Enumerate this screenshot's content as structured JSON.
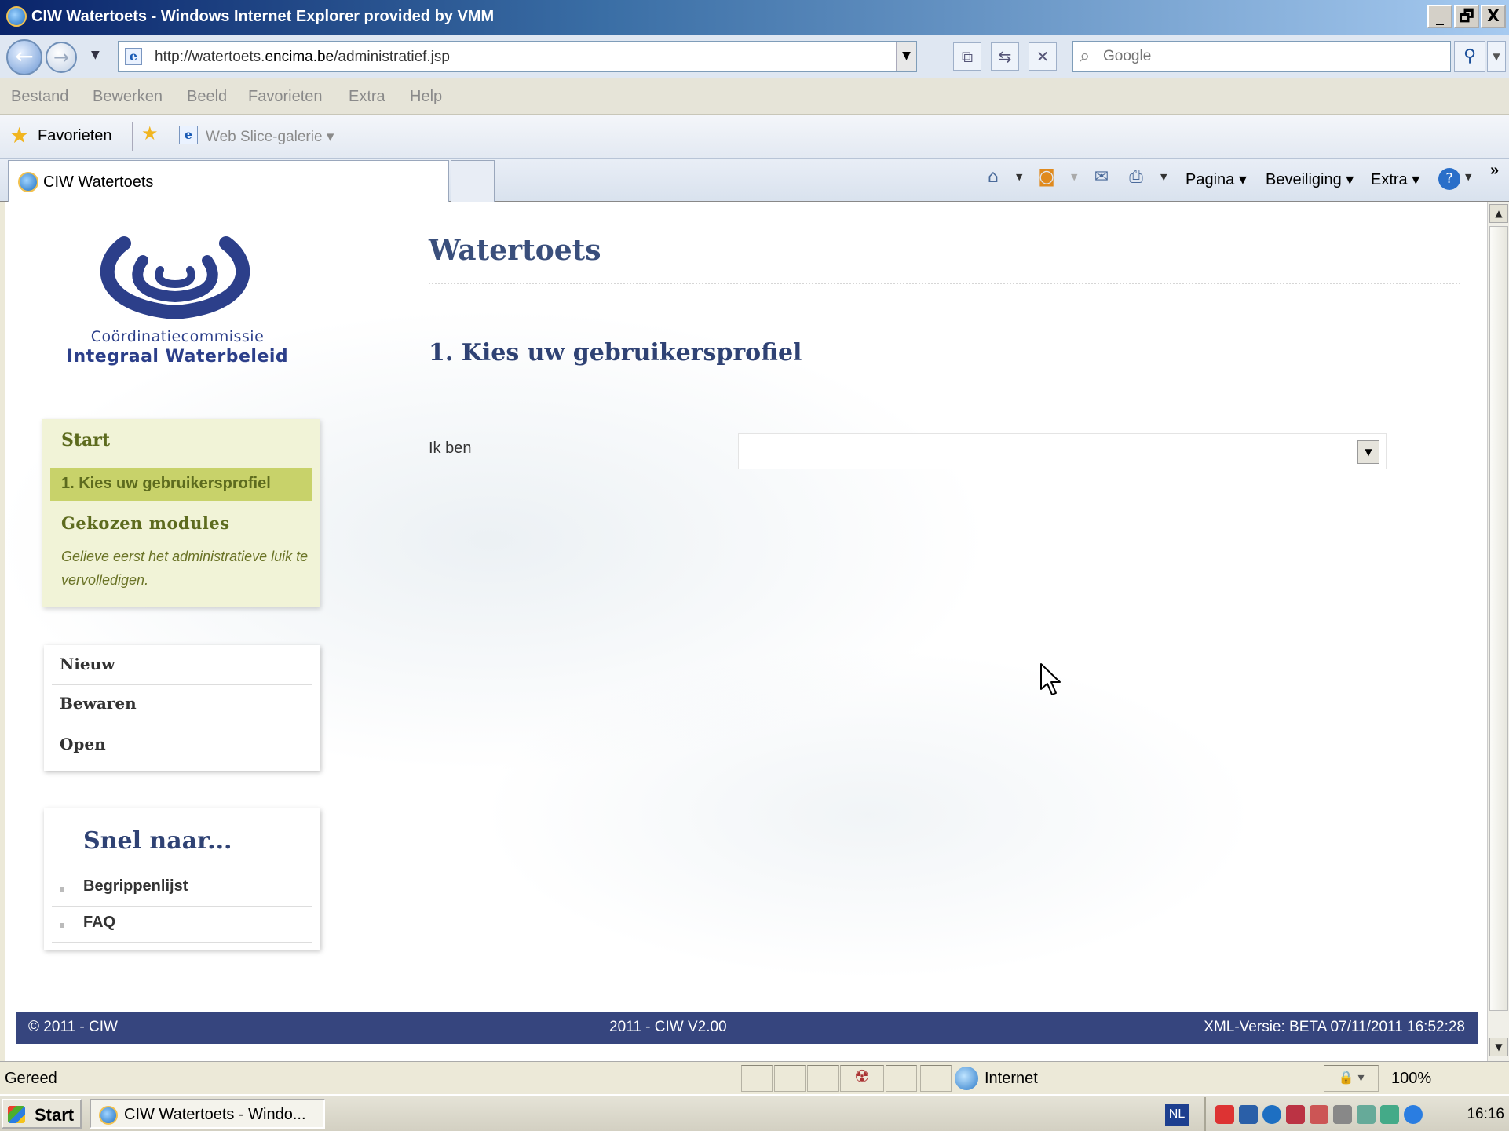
{
  "window": {
    "title": "CIW Watertoets - Windows Internet Explorer provided by VMM",
    "minimize": "_",
    "restore": "🗗",
    "close": "X"
  },
  "address": {
    "url_prefix": "http://watertoets.",
    "url_domain": "encima.be",
    "url_path": "/administratief.jsp",
    "search_placeholder": "Google"
  },
  "menu": [
    "Bestand",
    "Bewerken",
    "Beeld",
    "Favorieten",
    "Extra",
    "Help"
  ],
  "favorites": {
    "label": "Favorieten",
    "web_slice": "Web Slice-galerie ▾"
  },
  "tab": {
    "label": "CIW Watertoets"
  },
  "commandbar": {
    "pagina": "Pagina ▾",
    "beveiliging": "Beveiliging ▾",
    "extra": "Extra ▾",
    "more": "»"
  },
  "logo": {
    "line1": "Coördinatiecommissie",
    "line2": "Integraal Waterbeleid"
  },
  "steps": {
    "start": "Start",
    "active": "1. Kies uw gebruikersprofiel",
    "modules_title": "Gekozen modules",
    "modules_note": "Gelieve eerst het administratieve luik te vervolledigen."
  },
  "actions": [
    "Nieuw",
    "Bewaren",
    "Open"
  ],
  "snel": {
    "title": "Snel naar...",
    "links": [
      "Begrippenlijst",
      "FAQ"
    ]
  },
  "main": {
    "title": "Watertoets",
    "step_title": "1. Kies uw gebruikersprofiel",
    "field_label": "Ik ben",
    "select_value": ""
  },
  "footer": {
    "left": "© 2011 - CIW",
    "center": "2011 - CIW V2.00",
    "right": "XML-Versie: BETA 07/11/2011 16:52:28"
  },
  "statusbar": {
    "status": "Gereed",
    "zone": "Internet",
    "zoom": "100%"
  },
  "taskbar": {
    "start": "Start",
    "task": "CIW Watertoets - Windo...",
    "lang": "NL",
    "clock": "16:16"
  },
  "colors": {
    "brand_navy": "#36457e",
    "step_green_bg": "#c8d26a",
    "step_box_bg": "#f1f3d7",
    "title_blue": "#3a4f7c"
  }
}
